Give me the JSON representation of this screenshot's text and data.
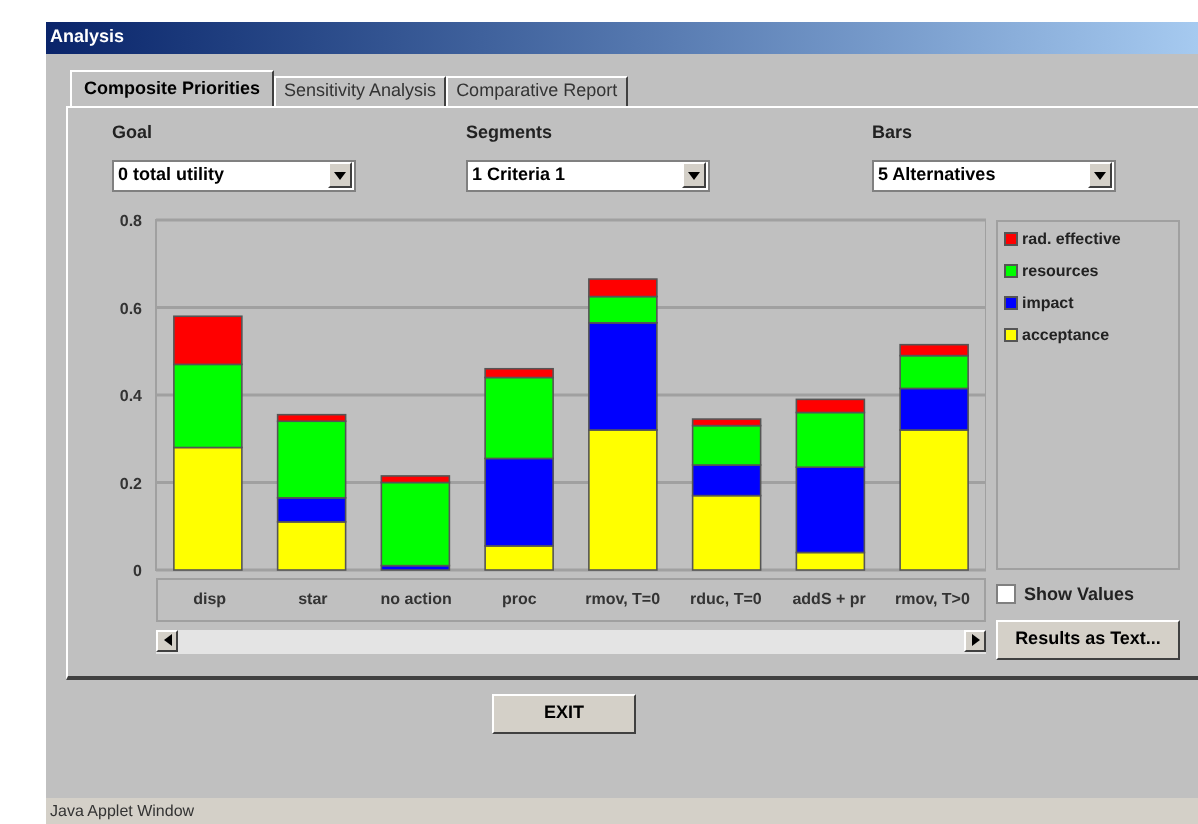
{
  "window": {
    "title": "Analysis"
  },
  "tabs": [
    {
      "label": "Composite Priorities",
      "selected": true
    },
    {
      "label": "Sensitivity Analysis",
      "selected": false
    },
    {
      "label": "Comparative Report",
      "selected": false
    }
  ],
  "selectors": [
    {
      "label": "Goal",
      "value": "0 total utility"
    },
    {
      "label": "Segments",
      "value": "1 Criteria 1"
    },
    {
      "label": "Bars",
      "value": "5 Alternatives"
    }
  ],
  "chart": {
    "chart_data": {
      "type": "bar",
      "stacked": true,
      "grid": true,
      "ylim": [
        0,
        0.8
      ],
      "yticks": [
        {
          "value": 0,
          "label": "0"
        },
        {
          "value": 0.2,
          "label": "0.2"
        },
        {
          "value": 0.4,
          "label": "0.4"
        },
        {
          "value": 0.6,
          "label": "0.6"
        },
        {
          "value": 0.8,
          "label": "0.8"
        }
      ],
      "categories": [
        "disp",
        "star",
        "no action",
        "proc",
        "rmov, T=0",
        "rduc, T=0",
        "addS + pr",
        "rmov, T>0"
      ],
      "series": [
        {
          "name": "rad. effective",
          "color": "#ff0000",
          "values": [
            0.11,
            0.015,
            0.015,
            0.02,
            0.04,
            0.015,
            0.03,
            0.025
          ]
        },
        {
          "name": "resources",
          "color": "#00ff00",
          "values": [
            0.19,
            0.175,
            0.19,
            0.185,
            0.06,
            0.09,
            0.125,
            0.075
          ]
        },
        {
          "name": "impact",
          "color": "#0000ff",
          "values": [
            0,
            0.055,
            0.01,
            0.2,
            0.245,
            0.07,
            0.195,
            0.095
          ]
        },
        {
          "name": "acceptance",
          "color": "#ffff00",
          "values": [
            0.28,
            0.11,
            0,
            0.055,
            0.32,
            0.17,
            0.04,
            0.32
          ]
        }
      ]
    }
  },
  "show_values": {
    "label": "Show Values",
    "checked": false
  },
  "results_button": "Results as Text...",
  "exit_button": "EXIT",
  "status_bar": "Java Applet Window"
}
